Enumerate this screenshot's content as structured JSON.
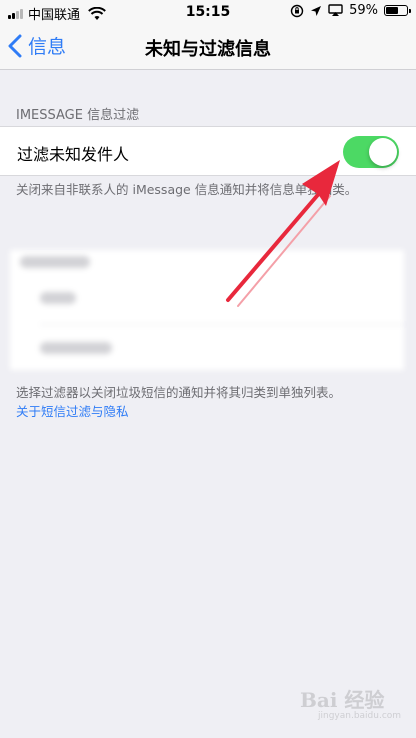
{
  "status_bar": {
    "carrier": "中国联通",
    "time": "15:15",
    "battery_percent": "59%",
    "battery_level": 0.59
  },
  "nav": {
    "back_label": "信息",
    "title": "未知与过滤信息"
  },
  "section": {
    "header": "IMESSAGE 信息过滤",
    "toggle_label": "过滤未知发件人",
    "toggle_on": true,
    "footer": "关闭来自非联系人的 iMessage 信息通知并将信息单独归类。"
  },
  "filter_section": {
    "footer": "选择过滤器以关闭垃圾短信的通知并将其归类到单独列表。",
    "privacy_link": "关于短信过滤与隐私"
  },
  "watermark": {
    "brand": "Bai 经验",
    "url": "jingyan.baidu.com"
  },
  "colors": {
    "accent": "#2f7cf6",
    "switch_on": "#4cd964",
    "annotation_arrow": "#e8283c",
    "background": "#efeff4"
  },
  "icons": [
    "cellular-signal-icon",
    "wifi-icon",
    "orientation-lock-icon",
    "location-icon",
    "airplay-icon",
    "battery-icon",
    "chevron-left-icon"
  ]
}
